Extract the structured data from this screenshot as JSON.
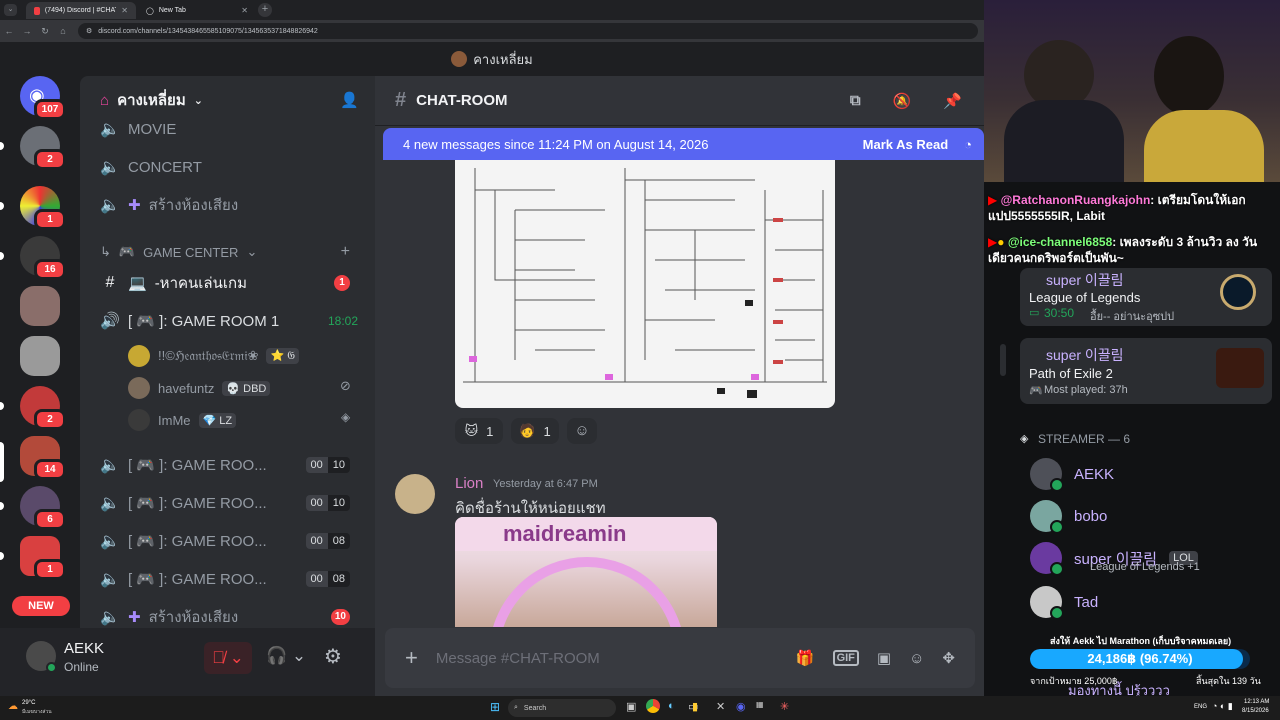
{
  "browser": {
    "tabs": [
      {
        "label": "(7494) Discord | #CHAT-ROOM",
        "active": true
      },
      {
        "label": "New Tab",
        "active": false
      }
    ],
    "url": "discord.com/channels/1345438465585109075/1345635371848826942"
  },
  "discord": {
    "title": "คางเหลี่ยม",
    "servers": [
      {
        "badge": "107",
        "color": "#5865f2"
      },
      {
        "badge": "2",
        "color": "#6b6f76"
      },
      {
        "badge": "1",
        "color": "#2c4a8a"
      },
      {
        "badge": "16",
        "color": "#3a3a3a"
      },
      {
        "badge": "",
        "color": "#8a6e6a"
      },
      {
        "badge": "",
        "color": "#9a9a9a"
      },
      {
        "badge": "2",
        "color": "#c23a3a"
      },
      {
        "badge": "14",
        "color": "#b34a3a"
      },
      {
        "badge": "6",
        "color": "#5a4a6a"
      },
      {
        "badge": "1",
        "color": "#d94040"
      }
    ],
    "new_badge": "NEW",
    "guild_name": "คางเหลี่ยม",
    "channels": {
      "movie": "MOVIE",
      "concert": "CONCERT",
      "create_voice_1": "สร้างห้องเสียง",
      "category": "GAME CENTER",
      "text_channel": "-หาคนเล่นเกม",
      "text_channel_badge": "1",
      "game_room_1": "[ 🎮 ]: GAME ROOM 1",
      "game_room_1_time": "18:02",
      "voice_users": [
        {
          "name": "!!©ℌ𝔢𝔞𝔫𝔱𝔥𝔬𝔰𝔈𝔯𝔪𝔦❀",
          "tag": "⭐ 𝔊"
        },
        {
          "name": "havefuntz",
          "tag": "💀 DBD"
        },
        {
          "name": "ImMe",
          "tag": "💎 LZ"
        }
      ],
      "game_rooms": [
        {
          "label": "[ 🎮 ]: GAME ROO...",
          "a": "00",
          "b": "10"
        },
        {
          "label": "[ 🎮 ]: GAME ROO...",
          "a": "00",
          "b": "10"
        },
        {
          "label": "[ 🎮 ]: GAME ROO...",
          "a": "00",
          "b": "08"
        },
        {
          "label": "[ 🎮 ]: GAME ROO...",
          "a": "00",
          "b": "08"
        }
      ],
      "create_voice_2": "สร้างห้องเสียง",
      "create_voice_2_badge": "10"
    },
    "user": {
      "name": "AEKK",
      "status": "Online"
    },
    "chat": {
      "channel": "CHAT-ROOM",
      "new_messages": "4 new messages since 11:24 PM on August 14, 2026",
      "mark_read": "Mark As Read",
      "reactions": [
        {
          "count": "1"
        },
        {
          "count": "1"
        }
      ],
      "message": {
        "author": "Lion",
        "time": "Yesterday at 6:47 PM",
        "text": "คิดชื่อร้านให้หน่อยแชท",
        "image_text": "maidreamin"
      },
      "composer_placeholder": "Message #CHAT-ROOM"
    }
  },
  "stream": {
    "chat": [
      {
        "user": "@RatchanonRuangkajohn",
        "text": ": เตรียมโดนให้เอกแปป5555555IR, Labit"
      },
      {
        "user": "@ice-channel6858",
        "text": ": เพลงระดับ 3 ล้านวิว ลง วันเดียวคนกดริพอร์ตเป็นพัน~"
      }
    ],
    "cards": [
      {
        "user": "super 이끌림",
        "game": "League of Legends",
        "time": "30:50",
        "detail": "อื้ย-- อย่านะอุซปป"
      },
      {
        "user": "super 이끌림",
        "game": "Path of Exile 2",
        "detail": "Most played: 37h"
      }
    ],
    "streamer_header": "STREAMER — 6",
    "members": [
      {
        "name": "AEKK"
      },
      {
        "name": "bobo"
      },
      {
        "name": "super 이끌림",
        "tag": "LOL",
        "sub": "League of Legends +1"
      },
      {
        "name": "Tad"
      }
    ],
    "donation": {
      "title": "ส่งให้ Aekk ไป Marathon (เก็บบริจาคหมดเลย)",
      "amount": "24,186฿ (96.74%)",
      "goal": "จากเป้าหมาย 25,000฿",
      "ends": "สิ้นสุดใน 139 วัน",
      "progress": 0.9674
    },
    "bottom_name": "มองทางนี้ ปรู้วววว"
  },
  "taskbar": {
    "weather": "29°C",
    "weather_sub": "มีเมฆบางส่วน",
    "search": "Search",
    "lang": "ENG",
    "time": "12:13 AM",
    "date": "8/15/2026"
  }
}
